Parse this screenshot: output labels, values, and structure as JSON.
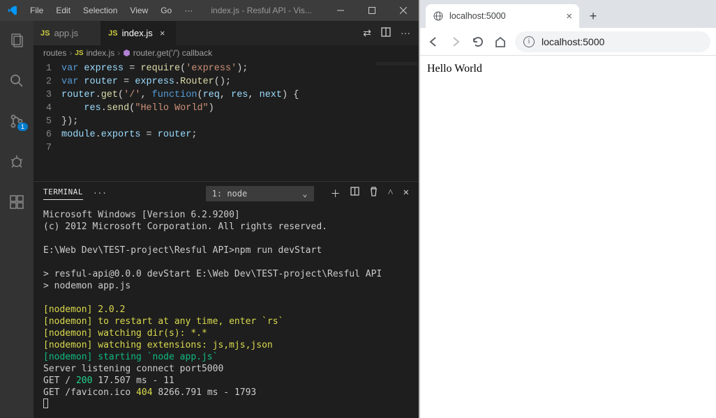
{
  "vscode": {
    "menus": [
      "File",
      "Edit",
      "Selection",
      "View",
      "Go",
      "···"
    ],
    "window_title": "index.js - Resful API - Vis...",
    "tabs": [
      {
        "icon_label": "JS",
        "label": "app.js",
        "active": false
      },
      {
        "icon_label": "JS",
        "label": "index.js",
        "active": true
      }
    ],
    "breadcrumb": {
      "folder": "routes",
      "file_icon": "JS",
      "file": "index.js",
      "symbol": "router.get('/') callback"
    },
    "code_lines": [
      {
        "n": "1",
        "tokens": [
          [
            "k-blue",
            "var "
          ],
          [
            "k-var",
            "express"
          ],
          [
            "k-pun",
            " = "
          ],
          [
            "k-fn",
            "require"
          ],
          [
            "k-pun",
            "("
          ],
          [
            "k-str",
            "'express'"
          ],
          [
            "k-pun",
            ");"
          ]
        ]
      },
      {
        "n": "2",
        "tokens": [
          [
            "k-blue",
            "var "
          ],
          [
            "k-var",
            "router"
          ],
          [
            "k-pun",
            " = "
          ],
          [
            "k-var",
            "express"
          ],
          [
            "k-pun",
            "."
          ],
          [
            "k-fn",
            "Router"
          ],
          [
            "k-pun",
            "();"
          ]
        ]
      },
      {
        "n": "3",
        "tokens": [
          [
            "k-var",
            "router"
          ],
          [
            "k-pun",
            "."
          ],
          [
            "k-fn",
            "get"
          ],
          [
            "k-pun",
            "("
          ],
          [
            "k-str",
            "'/'"
          ],
          [
            "k-pun",
            ", "
          ],
          [
            "k-blue",
            "function"
          ],
          [
            "k-pun",
            "("
          ],
          [
            "k-par",
            "req"
          ],
          [
            "k-pun",
            ", "
          ],
          [
            "k-par",
            "res"
          ],
          [
            "k-pun",
            ", "
          ],
          [
            "k-par",
            "next"
          ],
          [
            "k-pun",
            ") {"
          ]
        ]
      },
      {
        "n": "4",
        "tokens": [
          [
            "k-pun",
            "    "
          ],
          [
            "k-var",
            "res"
          ],
          [
            "k-pun",
            "."
          ],
          [
            "k-fn",
            "send"
          ],
          [
            "k-pun",
            "("
          ],
          [
            "k-str",
            "\"Hello World\""
          ],
          [
            "k-pun",
            ")"
          ]
        ]
      },
      {
        "n": "5",
        "tokens": [
          [
            "k-pun",
            "});"
          ]
        ]
      },
      {
        "n": "6",
        "tokens": [
          [
            "k-var",
            "module"
          ],
          [
            "k-pun",
            "."
          ],
          [
            "k-var",
            "exports"
          ],
          [
            "k-pun",
            " = "
          ],
          [
            "k-var",
            "router"
          ],
          [
            "k-pun",
            ";"
          ]
        ]
      },
      {
        "n": "7",
        "tokens": [
          [
            "k-pun",
            ""
          ]
        ]
      }
    ],
    "scm_badge": "1",
    "panel": {
      "title": "TERMINAL",
      "selector": "1: node",
      "lines": [
        {
          "cls": "",
          "text": "Microsoft Windows [Version 6.2.9200]"
        },
        {
          "cls": "",
          "text": "(c) 2012 Microsoft Corporation. All rights reserved."
        },
        {
          "cls": "",
          "text": ""
        },
        {
          "cls": "",
          "text": "E:\\Web Dev\\TEST-project\\Resful API>npm run devStart"
        },
        {
          "cls": "",
          "text": ""
        },
        {
          "cls": "",
          "text": "> resful-api@0.0.0 devStart E:\\Web Dev\\TEST-project\\Resful API"
        },
        {
          "cls": "",
          "text": "> nodemon app.js"
        },
        {
          "cls": "",
          "text": ""
        },
        {
          "cls": "t-yellow",
          "text": "[nodemon] 2.0.2"
        },
        {
          "cls": "t-yellow",
          "text": "[nodemon] to restart at any time, enter `rs`"
        },
        {
          "cls": "t-yellow",
          "text": "[nodemon] watching dir(s): *.*"
        },
        {
          "cls": "t-yellow",
          "text": "[nodemon] watching extensions: js,mjs,json"
        },
        {
          "cls": "t-green",
          "text": "[nodemon] starting `node app.js`"
        },
        {
          "cls": "",
          "text": "Server listening connect port5000"
        }
      ],
      "get1_prefix": "GET / ",
      "get1_status": "200",
      "get1_rest": " 17.507 ms - 11",
      "get2_prefix": "GET /favicon.ico ",
      "get2_status": "404",
      "get2_rest": " 8266.791 ms - 1793"
    }
  },
  "browser": {
    "tab_title": "localhost:5000",
    "url": "localhost:5000",
    "page_text": "Hello World"
  }
}
